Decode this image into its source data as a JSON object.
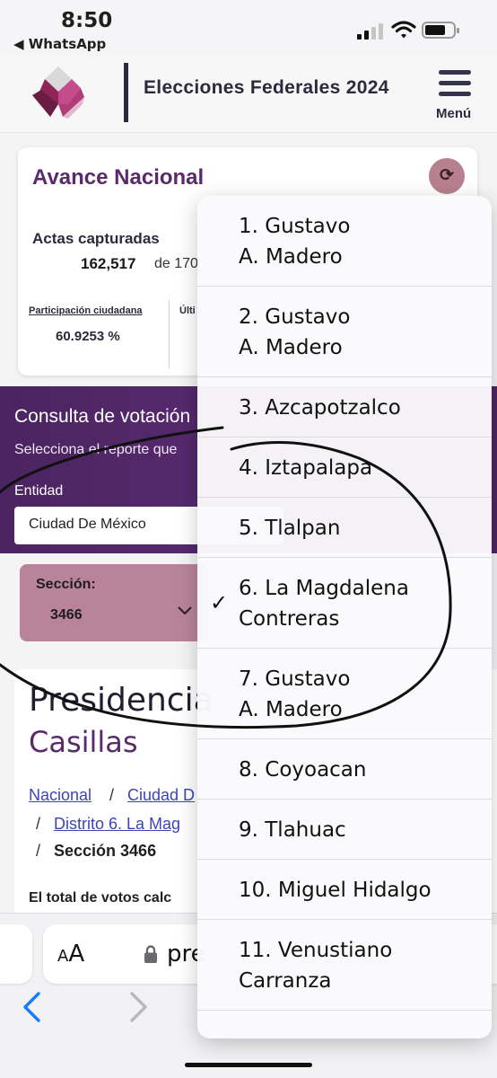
{
  "status_bar": {
    "time": "8:50",
    "back_app": "◀ WhatsApp"
  },
  "header": {
    "title": "Elecciones Federales 2024",
    "menu_label": "Menú"
  },
  "avance": {
    "title": "Avance Nacional",
    "refresh_icon": "refresh-icon",
    "actas_label": "Actas capturadas",
    "actas_count": "162,517",
    "actas_of": "de 170",
    "participacion_label": "Participación ciudadana",
    "participacion_value": "60.9253 %",
    "ultima_label": "Últi"
  },
  "consulta": {
    "title": "Consulta de votación",
    "subtitle": "Selecciona el reporte que",
    "entidad_label": "Entidad",
    "entidad_value": "Ciudad De México"
  },
  "seccion": {
    "label": "Sección:",
    "value": "3466"
  },
  "content": {
    "title": "Presidencia",
    "subtitle": "Casillas",
    "breadcrumb": [
      "Nacional",
      "Ciudad D",
      "Distrito 6. La Mag",
      "Sección 3466"
    ],
    "separator": "/",
    "total_text": "El total de votos calc"
  },
  "browser": {
    "aa_label": "AA",
    "url": "pre"
  },
  "dropdown": {
    "options": [
      {
        "label": "1. Gustavo\nA. Madero",
        "selected": false
      },
      {
        "label": "2. Gustavo\nA. Madero",
        "selected": false
      },
      {
        "label": "3. Azcapotzalco",
        "selected": false
      },
      {
        "label": "4. Iztapalapa",
        "selected": false
      },
      {
        "label": "5. Tlalpan",
        "selected": false
      },
      {
        "label": "6. La Magdalena\nContreras",
        "selected": true
      },
      {
        "label": "7. Gustavo\nA. Madero",
        "selected": false
      },
      {
        "label": "8. Coyoacan",
        "selected": false
      },
      {
        "label": "9. Tlahuac",
        "selected": false
      },
      {
        "label": "10. Miguel Hidalgo",
        "selected": false
      },
      {
        "label": "11. Venustiano\nCarranza",
        "selected": false
      }
    ],
    "check_mark": "✓"
  },
  "colors": {
    "brand_purple": "#5a2a6a",
    "band_purple": "#4b2461",
    "seccion_rose": "#b9849a",
    "ios_blue": "#1a7aff"
  }
}
